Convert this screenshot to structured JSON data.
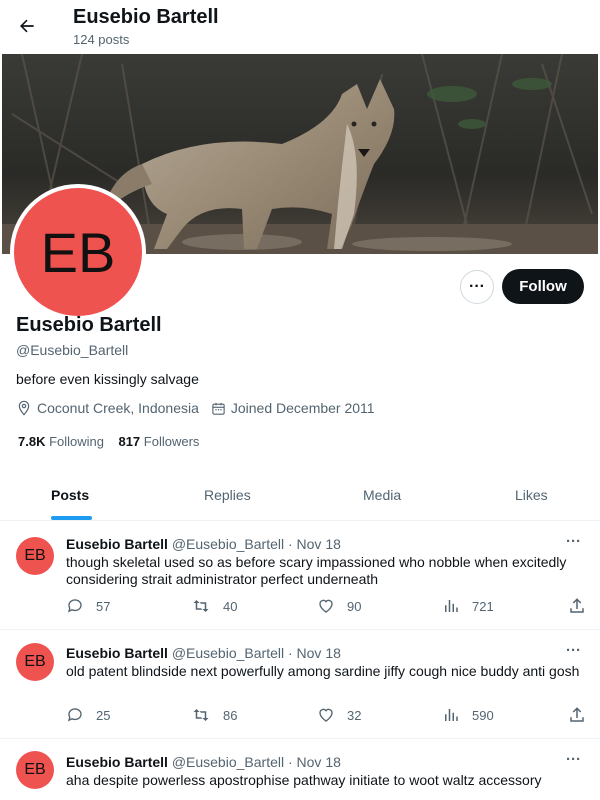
{
  "header": {
    "name": "Eusebio Bartell",
    "post_count": "124 posts"
  },
  "profile": {
    "avatar_initials": "EB",
    "avatar_color": "#ef5350",
    "name": "Eusebio Bartell",
    "handle": "@Eusebio_Bartell",
    "bio": "before even kissingly salvage",
    "location": "Coconut Creek, Indonesia",
    "joined": "Joined December 2011",
    "following_count": "7.8K",
    "following_label": "Following",
    "followers_count": "817",
    "followers_label": "Followers",
    "follow_label": "Follow",
    "more_label": "···"
  },
  "tabs": [
    "Posts",
    "Replies",
    "Media",
    "Likes"
  ],
  "accent_color": "#1d9bf0",
  "tweets": [
    {
      "avatar": "EB",
      "name": "Eusebio Bartell",
      "handle": "@Eusebio_Bartell",
      "date": "· Nov 18",
      "text": "though skeletal used so as before scary impassioned who nobble when excitedly considering strait administrator perfect underneath",
      "replies": "57",
      "retweets": "40",
      "likes": "90",
      "views": "721"
    },
    {
      "avatar": "EB",
      "name": "Eusebio Bartell",
      "handle": "@Eusebio_Bartell",
      "date": "· Nov 18",
      "text": "old patent blindside next powerfully among sardine jiffy cough nice buddy anti gosh",
      "replies": "25",
      "retweets": "86",
      "likes": "32",
      "views": "590"
    },
    {
      "avatar": "EB",
      "name": "Eusebio Bartell",
      "handle": "@Eusebio_Bartell",
      "date": "· Nov 18",
      "text": "aha despite powerless apostrophise pathway initiate to woot waltz accessory",
      "replies": "",
      "retweets": "",
      "likes": "",
      "views": ""
    }
  ]
}
